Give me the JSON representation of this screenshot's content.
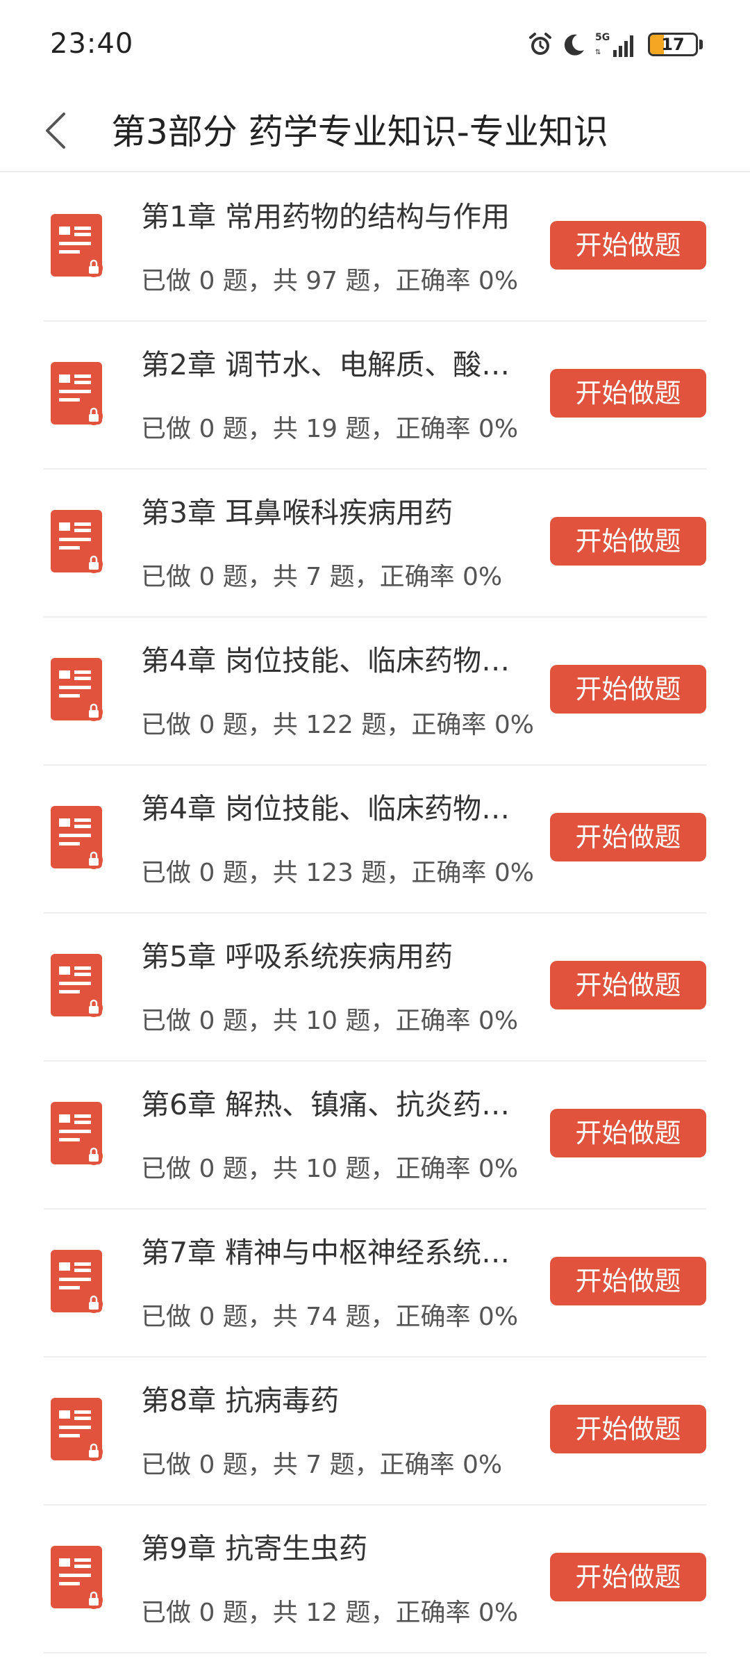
{
  "status": {
    "time": "23:40",
    "battery": "17",
    "network": "5G"
  },
  "header": {
    "title": "第3部分 药学专业知识-专业知识"
  },
  "colors": {
    "accent": "#e1533d",
    "battery_fill": "#f5a623"
  },
  "chapters": [
    {
      "title": "第1章 常用药物的结构与作用",
      "stats": "已做 0 题，共 97 题，正确率 0%",
      "button": "开始做题"
    },
    {
      "title": "第2章 调节水、电解质、酸…",
      "stats": "已做 0 题，共 19 题，正确率 0%",
      "button": "开始做题"
    },
    {
      "title": "第3章 耳鼻喉科疾病用药",
      "stats": "已做 0 题，共 7 题，正确率 0%",
      "button": "开始做题"
    },
    {
      "title": "第4章 岗位技能、临床药物…",
      "stats": "已做 0 题，共 122 题，正确率 0%",
      "button": "开始做题"
    },
    {
      "title": "第4章 岗位技能、临床药物…",
      "stats": "已做 0 题，共 123 题，正确率 0%",
      "button": "开始做题"
    },
    {
      "title": "第5章 呼吸系统疾病用药",
      "stats": "已做 0 题，共 10 题，正确率 0%",
      "button": "开始做题"
    },
    {
      "title": "第6章 解热、镇痛、抗炎药…",
      "stats": "已做 0 题，共 10 题，正确率 0%",
      "button": "开始做题"
    },
    {
      "title": "第7章 精神与中枢神经系统…",
      "stats": "已做 0 题，共 74 题，正确率 0%",
      "button": "开始做题"
    },
    {
      "title": "第8章 抗病毒药",
      "stats": "已做 0 题，共 7 题，正确率 0%",
      "button": "开始做题"
    },
    {
      "title": "第9章 抗寄生虫药",
      "stats": "已做 0 题，共 12 题，正确率 0%",
      "button": "开始做题"
    }
  ]
}
